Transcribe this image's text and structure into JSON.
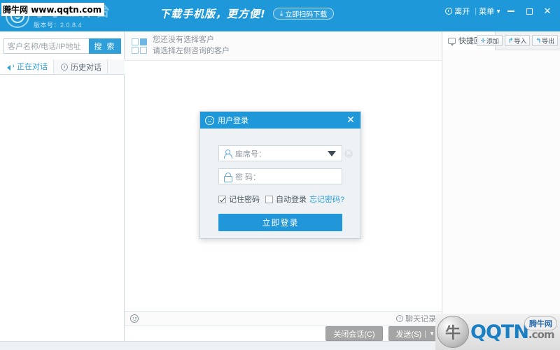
{
  "titlebar": {
    "logo_icon": "smiley-circle-logo",
    "app_title": "学学工作台",
    "version": "版本号：2.0.8.4",
    "banner_text": "下载手机版，更方便!",
    "banner_button": "立即扫码下载",
    "banner_button_icon": "download-icon",
    "leave_label": "离开",
    "leave_icon": "clock-icon",
    "separator": "|",
    "menu_label": "菜单",
    "menu_caret": "▼",
    "minimize_icon": "minimize-icon",
    "maximize_icon": "maximize-icon",
    "close_label": "✕"
  },
  "watermark_top": {
    "site_cn": "腾牛网",
    "site_url": "www.qqtn.com"
  },
  "left_panel": {
    "search_placeholder": "客户名称/电话/IP地址",
    "search_value": "",
    "search_button": "搜 索",
    "tabs": [
      {
        "label": "正在对话",
        "icon": "speaker-icon",
        "active": true
      },
      {
        "label": "历史对话",
        "icon": "history-clock-icon",
        "active": false
      }
    ]
  },
  "center_panel": {
    "empty_icon": "grid-placeholder-icon",
    "empty_title": "您还没有选择客户",
    "empty_subtitle": "请选择左侧咨询的客户",
    "emoji_icon": "emoji-smiley-icon",
    "chat_log_label": "聊天记录",
    "chat_log_icon": "clock-icon",
    "input_value": "",
    "close_session_button": "关闭会话(C)",
    "send_button": "发送(S)",
    "send_separator": "|",
    "send_caret": "▼"
  },
  "right_panel": {
    "tab_label": "快捷回复",
    "tab_icon": "speech-bubble-icon",
    "tools": [
      {
        "icon": "plus-icon",
        "glyph": "✛",
        "label": "添加"
      },
      {
        "icon": "import-arrow-icon",
        "glyph": "↱",
        "label": "导入"
      },
      {
        "icon": "export-arrow-icon",
        "glyph": "↰",
        "label": "导出"
      }
    ]
  },
  "login_dialog": {
    "title": "用户登录",
    "title_icon": "smiley-icon",
    "close_icon": "✕",
    "seat_icon": "user-icon",
    "seat_label": "座席号：",
    "seat_value": "",
    "dropdown_icon": "chevron-down-icon",
    "clear_icon": "✕",
    "password_icon": "lock-icon",
    "password_label": "密  码：",
    "password_value": "",
    "remember_label": "记住密码",
    "remember_checked": true,
    "autologin_label": "自动登录",
    "autologin_checked": false,
    "forgot_label": "忘记密码?",
    "login_button": "立即登录"
  },
  "watermark_bottom": {
    "brand": "QQTN",
    "suffix": ".com",
    "badge": "腾牛网",
    "globe_icon": "qqtn-globe-logo"
  },
  "colors": {
    "brand_blue": "#1f98d9",
    "accent_blue": "#2e9fd9",
    "dialog_bg": "#eef2f5",
    "panel_border": "#d3dce3",
    "muted_text": "#8a939b"
  }
}
